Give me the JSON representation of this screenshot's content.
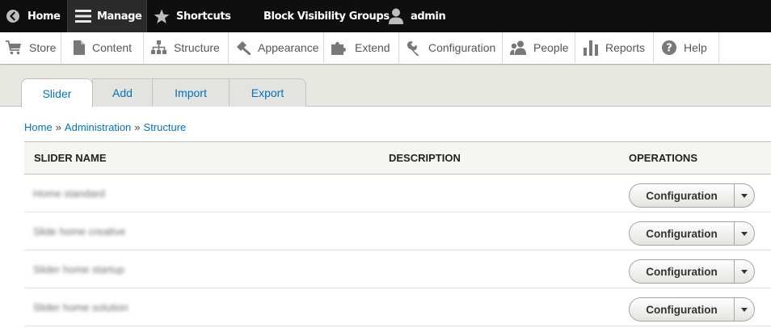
{
  "toolbar": {
    "home_label": "Home",
    "manage_label": "Manage",
    "shortcuts_label": "Shortcuts",
    "block_visibility_label": "Block Visibility Groups",
    "user_label": "admin",
    "background_color": "#0f0f0f"
  },
  "tray": {
    "items": [
      {
        "label": "Store",
        "icon": "cart-icon"
      },
      {
        "label": "Content",
        "icon": "document-icon"
      },
      {
        "label": "Structure",
        "icon": "sitemap-icon"
      },
      {
        "label": "Appearance",
        "icon": "paint-brush-icon"
      },
      {
        "label": "Extend",
        "icon": "puzzle-icon"
      },
      {
        "label": "Configuration",
        "icon": "wrench-icon"
      },
      {
        "label": "People",
        "icon": "people-icon"
      },
      {
        "label": "Reports",
        "icon": "bar-chart-icon"
      },
      {
        "label": "Help",
        "icon": "help-icon"
      }
    ]
  },
  "tabs": [
    {
      "label": "Slider",
      "active": true
    },
    {
      "label": "Add",
      "active": false
    },
    {
      "label": "Import",
      "active": false
    },
    {
      "label": "Export",
      "active": false
    }
  ],
  "breadcrumb": {
    "items": [
      "Home",
      "Administration",
      "Structure"
    ],
    "separator": "»"
  },
  "table": {
    "headers": {
      "name": "Slider name",
      "description": "Description",
      "operations": "Operations"
    },
    "rows": [
      {
        "name": "Home standard",
        "description": "",
        "operation": "Configuration"
      },
      {
        "name": "Slide home creative",
        "description": "",
        "operation": "Configuration"
      },
      {
        "name": "Slider home startup",
        "description": "",
        "operation": "Configuration"
      },
      {
        "name": "Slider home solution",
        "description": "",
        "operation": "Configuration"
      }
    ]
  },
  "colors": {
    "link": "#0074bd",
    "tabs_background": "#e8e8e3"
  }
}
